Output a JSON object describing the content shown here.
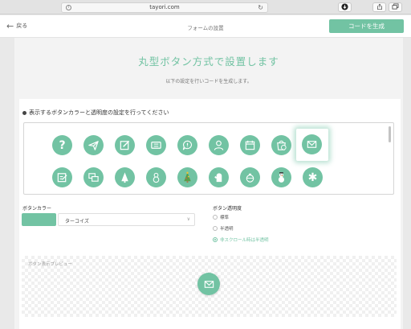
{
  "browser": {
    "url": "tayori.com",
    "info_icon": "info-icon",
    "reload_icon": "reload-icon",
    "buttons": [
      "download-icon",
      "share-icon",
      "tabs-icon"
    ]
  },
  "header": {
    "back_label": "戻る",
    "title": "フォームの設置",
    "generate_button": "コードを生成"
  },
  "main": {
    "title": "丸型ボタン方式で設置します",
    "subtitle": "以下の設定を行いコードを生成します。",
    "section_heading": "表示するボタンカラーと透明度の設定を行ってください"
  },
  "icons": {
    "row1": [
      "question-icon",
      "paper-plane-icon",
      "pencil-note-icon",
      "ticket-icon",
      "speech-bubble-icon",
      "person-icon",
      "calendar-icon",
      "question-bag-icon",
      "envelope-icon"
    ],
    "row2": [
      "edit-note-icon",
      "chat-windows-icon",
      "tree-icon",
      "snowman-outline-icon",
      "christmas-tree-icon",
      "mitten-icon",
      "ornament-icon",
      "snowman-icon",
      "snowflake-icon"
    ],
    "selected": "envelope-icon"
  },
  "color": {
    "label": "ボタンカラー",
    "value": "ターコイズ",
    "swatch": "#72c3a3"
  },
  "opacity": {
    "label": "ボタン透明度",
    "options": [
      "標準",
      "半透明",
      "非スクロール時は半透明"
    ],
    "selected": "非スクロール時は半透明"
  },
  "preview": {
    "label": "ボタン表示プレビュー",
    "icon": "envelope-icon"
  },
  "colors": {
    "accent": "#72c3a3",
    "background": "#f3f3f3"
  }
}
